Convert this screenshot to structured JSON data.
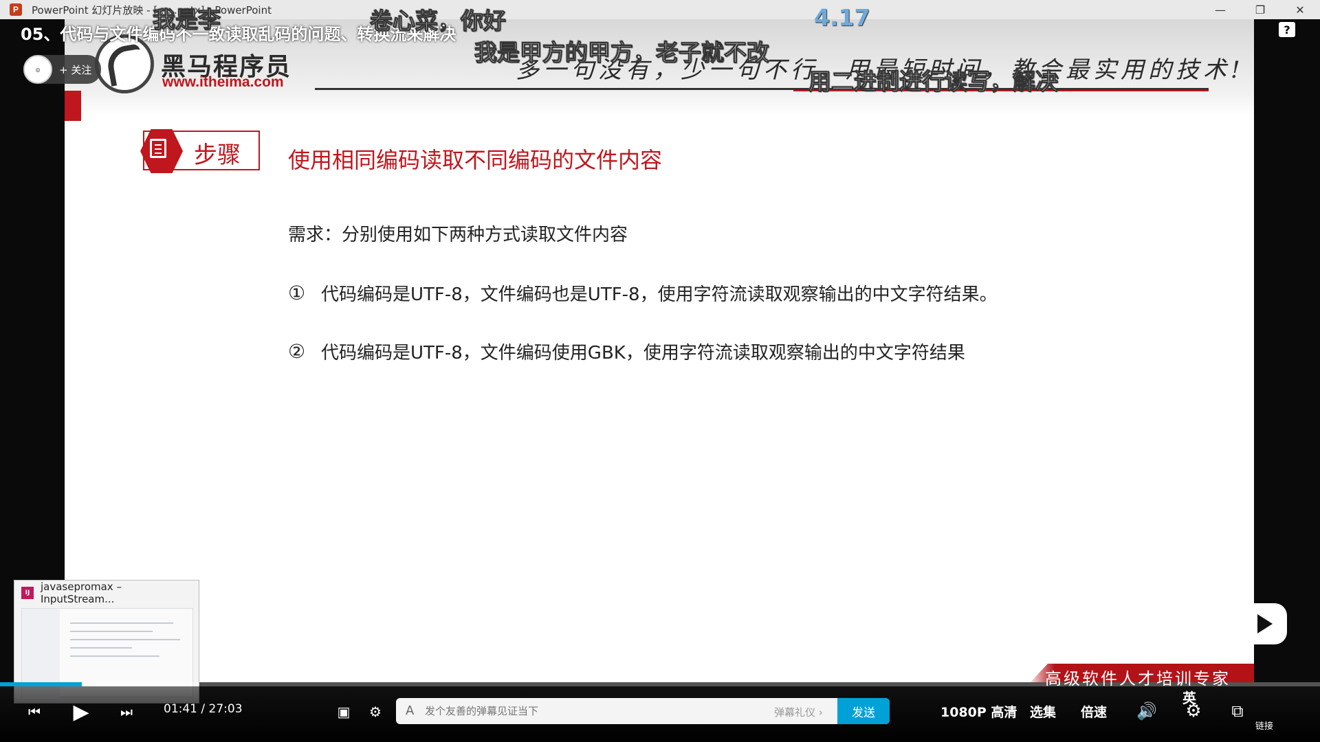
{
  "window": {
    "title": "PowerPoint 幻灯片放映 - [ ... .pptx] - PowerPoint",
    "app_icon": "P",
    "minimize": "—",
    "restore": "❐",
    "close": "✕"
  },
  "video": {
    "title": "05、代码与文件编码不一致读取乱码的问题、转换流来解决",
    "follow_label": "+ 关注",
    "help": "?"
  },
  "slide": {
    "brand_name": "黑马程序员",
    "brand_url": "www.itheima.com",
    "slogan": "多一句没有，少一句不行，用最短时间，教会最实用的技术!",
    "step_label": "步骤",
    "title": "使用相同编码读取不同编码的文件内容",
    "requirement": "需求：分别使用如下两种方式读取文件内容",
    "items": [
      {
        "num": "①",
        "text": "代码编码是UTF-8，文件编码也是UTF-8，使用字符流读取观察输出的中文字符结果。"
      },
      {
        "num": "②",
        "text": "代码编码是UTF-8，文件编码使用GBK，使用字符流读取观察输出的中文字符结果"
      }
    ],
    "banner": "高级软件人才培训专家"
  },
  "danmaku": [
    "我是李",
    "卷心菜，你好",
    "4.17",
    "我是甲方的甲方，老子就不改",
    "用二进制进行读写，解决"
  ],
  "taskbar_preview": {
    "title": "javasepromax – InputStream..."
  },
  "player": {
    "current_time": "01:41",
    "separator": "/",
    "total_time": "27:03",
    "progress": 0.062,
    "danmaku_placeholder": "发个友善的弹幕见证当下",
    "danmaku_etiquette": "弹幕礼仪 ›",
    "send_label": "发送",
    "quality": "1080P 高清",
    "episodes": "选集",
    "speed": "倍速",
    "subtitle": "英",
    "link_label": "链接"
  },
  "colors": {
    "brand_red": "#c0161d",
    "bilibili_blue": "#00a1d6"
  }
}
